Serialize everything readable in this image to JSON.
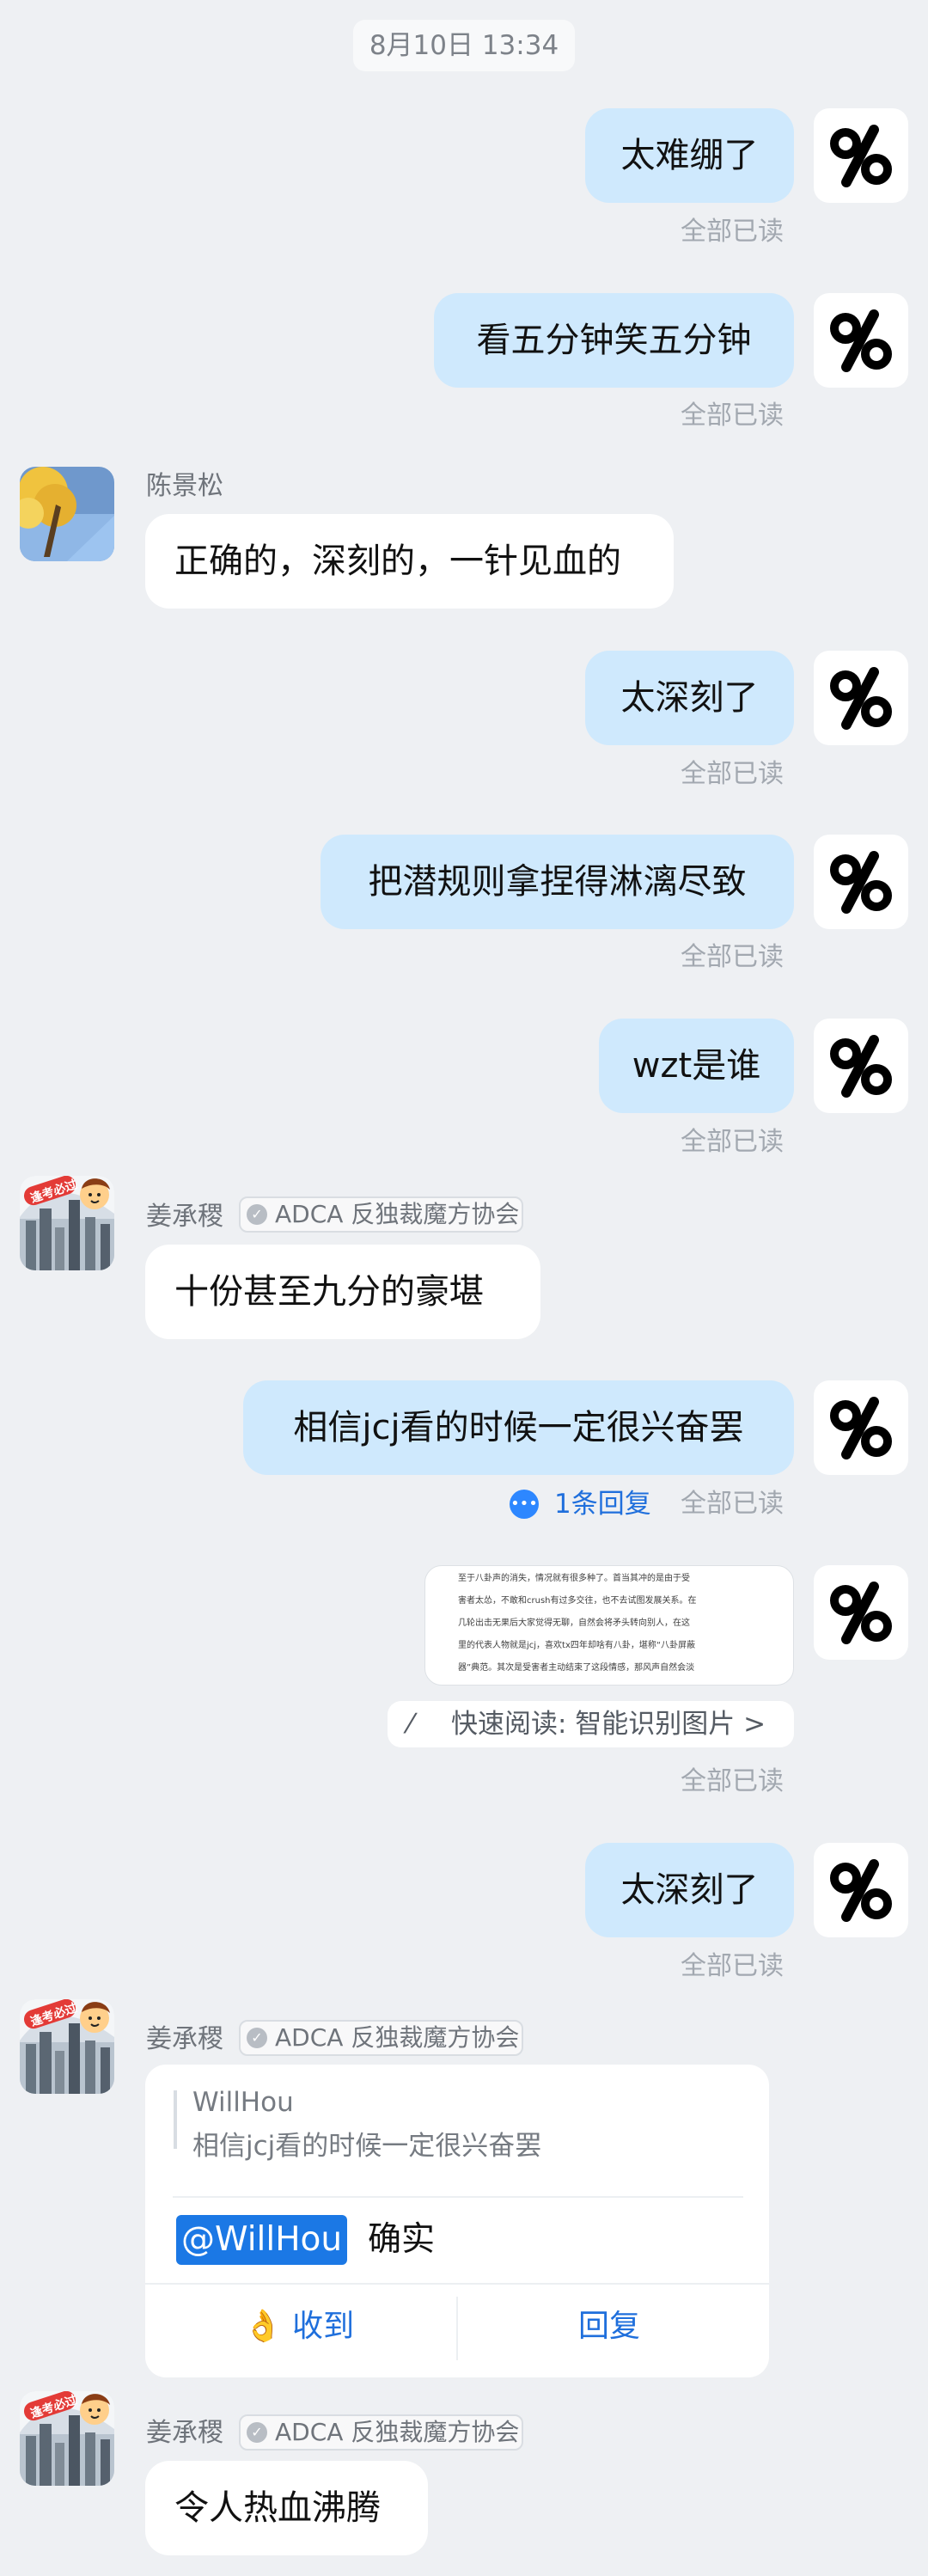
{
  "header": {
    "date_time": "8月10日 13:34"
  },
  "messages": [
    {
      "text": "太难绷了",
      "read": "全部已读"
    },
    {
      "text": "看五分钟笑五分钟",
      "read": "全部已读"
    },
    {
      "sender": "陈景松",
      "text": "正确的，深刻的，一针见血的"
    },
    {
      "text": "太深刻了",
      "read": "全部已读"
    },
    {
      "text": "把潜规则拿捏得淋漓尽致",
      "read": "全部已读"
    },
    {
      "text": "wzt是谁",
      "read": "全部已读"
    },
    {
      "sender": "姜承稷",
      "badge": "ADCA 反独裁魔方协会",
      "text": "十份甚至九分的豪堪"
    },
    {
      "text": "相信jcj看的时候一定很兴奋罢",
      "reply_count": "1条回复",
      "read": "全部已读"
    },
    {
      "image_preview_lines": [
        "至于八卦声的消失，情况就有很多种了。首当其冲的是由于受",
        "害者太怂，不敢和crush有过多交往，也不去试图发展关系。在",
        "几轮出击无果后大家觉得无聊，自然会将矛头转向别人，在这",
        "里的代表人物就是jcj，喜欢tx四年却啥有八卦，堪称“八卦屏蔽",
        "器”典范。其次是受害者主动结束了这段情感，那风声自然会淡"
      ],
      "quick_read": "快速阅读: 智能识别图片 >",
      "read": "全部已读"
    },
    {
      "text": "太深刻了",
      "read": "全部已读"
    },
    {
      "sender": "姜承稷",
      "badge": "ADCA 反独裁魔方协会",
      "quote_author": "WillHou",
      "quote_text": "相信jcj看的时候一定很兴奋罢",
      "mention": "@WillHou",
      "text": "确实",
      "received_label": "收到",
      "reply_label": "回复"
    },
    {
      "sender": "姜承稷",
      "badge": "ADCA 反独裁魔方协会",
      "text": "令人热血沸腾"
    }
  ],
  "colors": {
    "background": "#eef0f3",
    "my_bubble": "#cfe9fd",
    "other_bubble": "#ffffff",
    "link_blue": "#1f6fdc"
  },
  "icons": {
    "my_avatar": "percent-logo-icon",
    "reply": "chat-bubble-icon",
    "quick_read": "magic-wand-icon",
    "received": "ok-hand-icon",
    "verified": "verified-badge-icon"
  }
}
